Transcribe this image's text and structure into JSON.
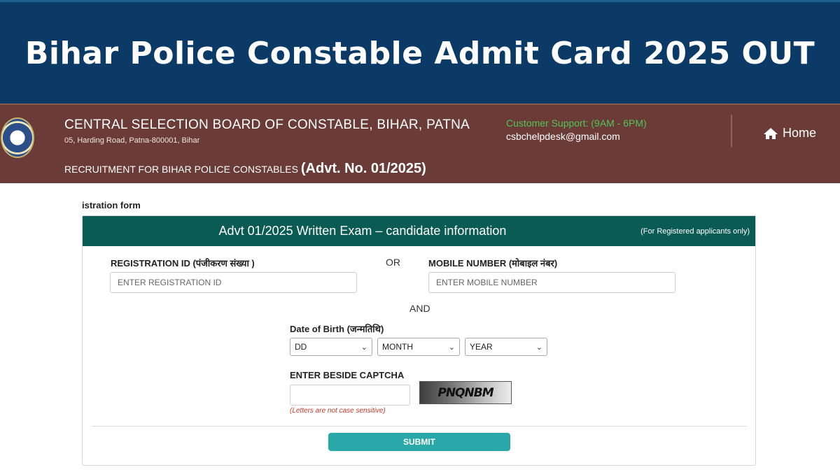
{
  "banner": {
    "title": "Bihar Police Constable Admit Card 2025 OUT"
  },
  "header": {
    "org_name": "CENTRAL SELECTION BOARD OF CONSTABLE, BIHAR, PATNA",
    "address": "05, Harding Road, Patna-800001, Bihar",
    "recruitment_prefix": "RECRUITMENT FOR BIHAR POLICE CONSTABLES ",
    "advt": "(Advt. No. 01/2025)",
    "support_label": "Customer Support: (9AM - 6PM)",
    "support_email": "csbchelpdesk@gmail.com",
    "home_label": "Home"
  },
  "form": {
    "caption": "istration form",
    "panel_title": "Advt 01/2025 Written Exam – candidate information",
    "panel_note": "(For Registered applicants only)",
    "registration_label": "REGISTRATION ID (पंजीकरण संख्या )",
    "registration_placeholder": "ENTER REGISTRATION ID",
    "or_text": "OR",
    "mobile_label": "MOBILE NUMBER (मोबाइल नंबर)",
    "mobile_placeholder": "ENTER MOBILE NUMBER",
    "and_text": "AND",
    "dob_label": "Date of Birth (जन्मतिथि)",
    "dob_day": "DD",
    "dob_month": "MONTH",
    "dob_year": "YEAR",
    "captcha_label": "ENTER BESIDE CAPTCHA",
    "captcha_code": "PNQNBM",
    "captcha_hint": "(Letters are not case sensitive)",
    "submit_label": "SUBMIT"
  },
  "colors": {
    "banner_bg": "#0b3a66",
    "header_bg": "#6b3b37",
    "panel_head_bg": "#0b5b55",
    "support_text": "#52c458",
    "submit_bg": "#2aa7a9",
    "hint_text": "#c0392b"
  },
  "icons": {
    "home": "home-icon",
    "emblem": "emblem-logo",
    "dropdown": "chevron-down-icon"
  }
}
